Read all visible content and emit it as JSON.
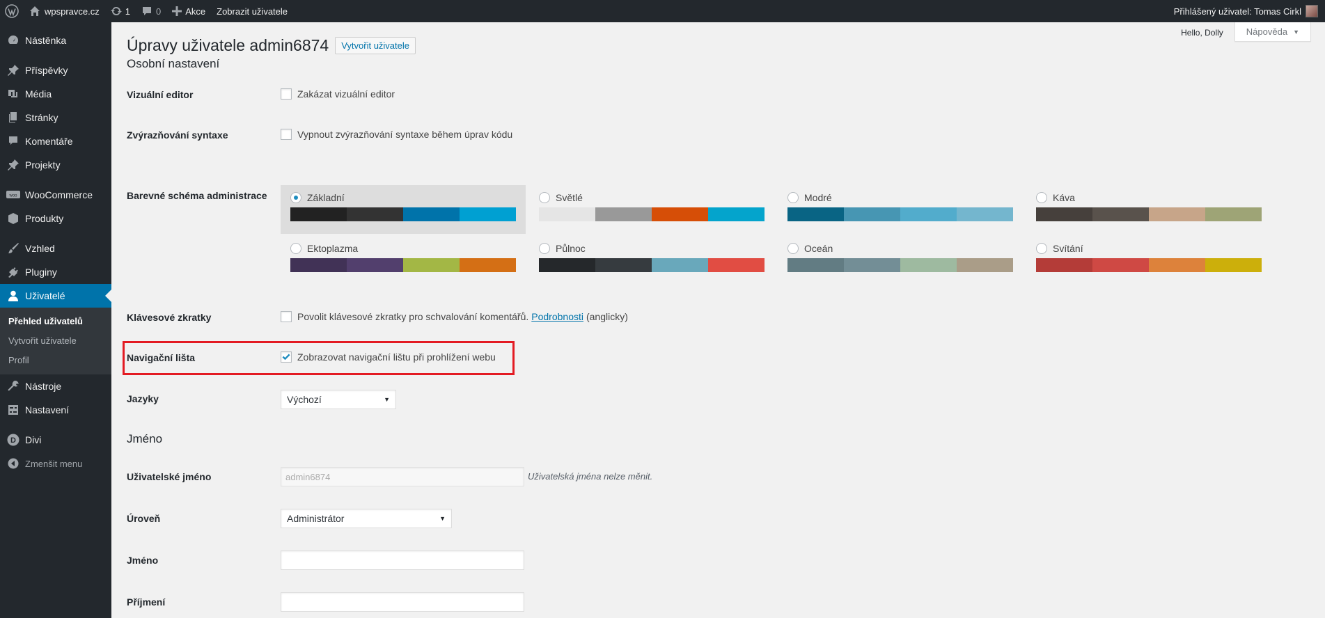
{
  "adminbar": {
    "site_name": "wpspravce.cz",
    "updates_count": "1",
    "comments_count": "0",
    "new_label": "Akce",
    "view_user_label": "Zobrazit uživatele",
    "howdy": "Přihlášený uživatel: Tomas Cirkl"
  },
  "sidebar": {
    "items": [
      {
        "label": "Nástěnka",
        "icon": "dashboard-icon"
      },
      {
        "label": "Příspěvky",
        "icon": "pin-icon"
      },
      {
        "label": "Média",
        "icon": "media-icon"
      },
      {
        "label": "Stránky",
        "icon": "pages-icon"
      },
      {
        "label": "Komentáře",
        "icon": "comment-icon"
      },
      {
        "label": "Projekty",
        "icon": "pin-icon"
      },
      {
        "label": "WooCommerce",
        "icon": "woo-icon"
      },
      {
        "label": "Produkty",
        "icon": "box-icon"
      },
      {
        "label": "Vzhled",
        "icon": "brush-icon"
      },
      {
        "label": "Pluginy",
        "icon": "plug-icon"
      },
      {
        "label": "Uživatelé",
        "icon": "user-icon"
      },
      {
        "label": "Nástroje",
        "icon": "wrench-icon"
      },
      {
        "label": "Nastavení",
        "icon": "settings-icon"
      },
      {
        "label": "Divi",
        "icon": "divi-icon"
      },
      {
        "label": "Zmenšit menu",
        "icon": "collapse-icon"
      }
    ],
    "submenu": [
      "Přehled uživatelů",
      "Vytvořit uživatele",
      "Profil"
    ]
  },
  "screen_meta": {
    "hello": "Hello, Dolly",
    "help": "Nápověda"
  },
  "page": {
    "title": "Úpravy uživatele admin6874",
    "add_new": "Vytvořit uživatele",
    "section_personal": "Osobní nastavení",
    "section_name": "Jméno"
  },
  "rows": {
    "visual_editor": {
      "label": "Vizuální editor",
      "text": "Zakázat vizuální editor",
      "checked": false
    },
    "syntax": {
      "label": "Zvýrazňování syntaxe",
      "text": "Vypnout zvýrazňování syntaxe během úprav kódu",
      "checked": false
    },
    "color_scheme": {
      "label": "Barevné schéma administrace"
    },
    "shortcuts": {
      "label": "Klávesové zkratky",
      "text": "Povolit klávesové zkratky pro schvalování komentářů.",
      "link": "Podrobnosti",
      "suffix": "(anglicky)",
      "checked": false
    },
    "toolbar": {
      "label": "Navigační lišta",
      "text": "Zobrazovat navigační lištu při prohlížení webu",
      "checked": true
    },
    "language": {
      "label": "Jazyky",
      "value": "Výchozí"
    },
    "username": {
      "label": "Uživatelské jméno",
      "value": "admin6874",
      "desc": "Uživatelská jména nelze měnit."
    },
    "role": {
      "label": "Úroveň",
      "value": "Administrátor"
    },
    "first_name": {
      "label": "Jméno",
      "value": ""
    },
    "last_name": {
      "label": "Příjmení",
      "value": ""
    }
  },
  "schemes": [
    {
      "name": "Základní",
      "selected": true,
      "colors": [
        "#222222",
        "#333333",
        "#0073aa",
        "#00a0d2"
      ]
    },
    {
      "name": "Světlé",
      "selected": false,
      "colors": [
        "#e5e5e5",
        "#999999",
        "#d64e07",
        "#04a4cc"
      ]
    },
    {
      "name": "Modré",
      "selected": false,
      "colors": [
        "#096484",
        "#4796b3",
        "#52accc",
        "#74b6ce"
      ]
    },
    {
      "name": "Káva",
      "selected": false,
      "colors": [
        "#46403c",
        "#59524c",
        "#c7a589",
        "#9ea476"
      ]
    },
    {
      "name": "Ektoplazma",
      "selected": false,
      "colors": [
        "#413256",
        "#523f6d",
        "#a3b745",
        "#d46f15"
      ]
    },
    {
      "name": "Půlnoc",
      "selected": false,
      "colors": [
        "#25282b",
        "#363b3f",
        "#69a8bb",
        "#e14d43"
      ]
    },
    {
      "name": "Oceán",
      "selected": false,
      "colors": [
        "#627c83",
        "#738e96",
        "#9ebaa0",
        "#aa9d88"
      ]
    },
    {
      "name": "Svítání",
      "selected": false,
      "colors": [
        "#b43c38",
        "#cf4944",
        "#dd823b",
        "#ccaf0b"
      ]
    }
  ],
  "colors": {
    "accent": "#0073aa",
    "highlight": "#e31b23",
    "sidebar_bg": "#23282d"
  }
}
